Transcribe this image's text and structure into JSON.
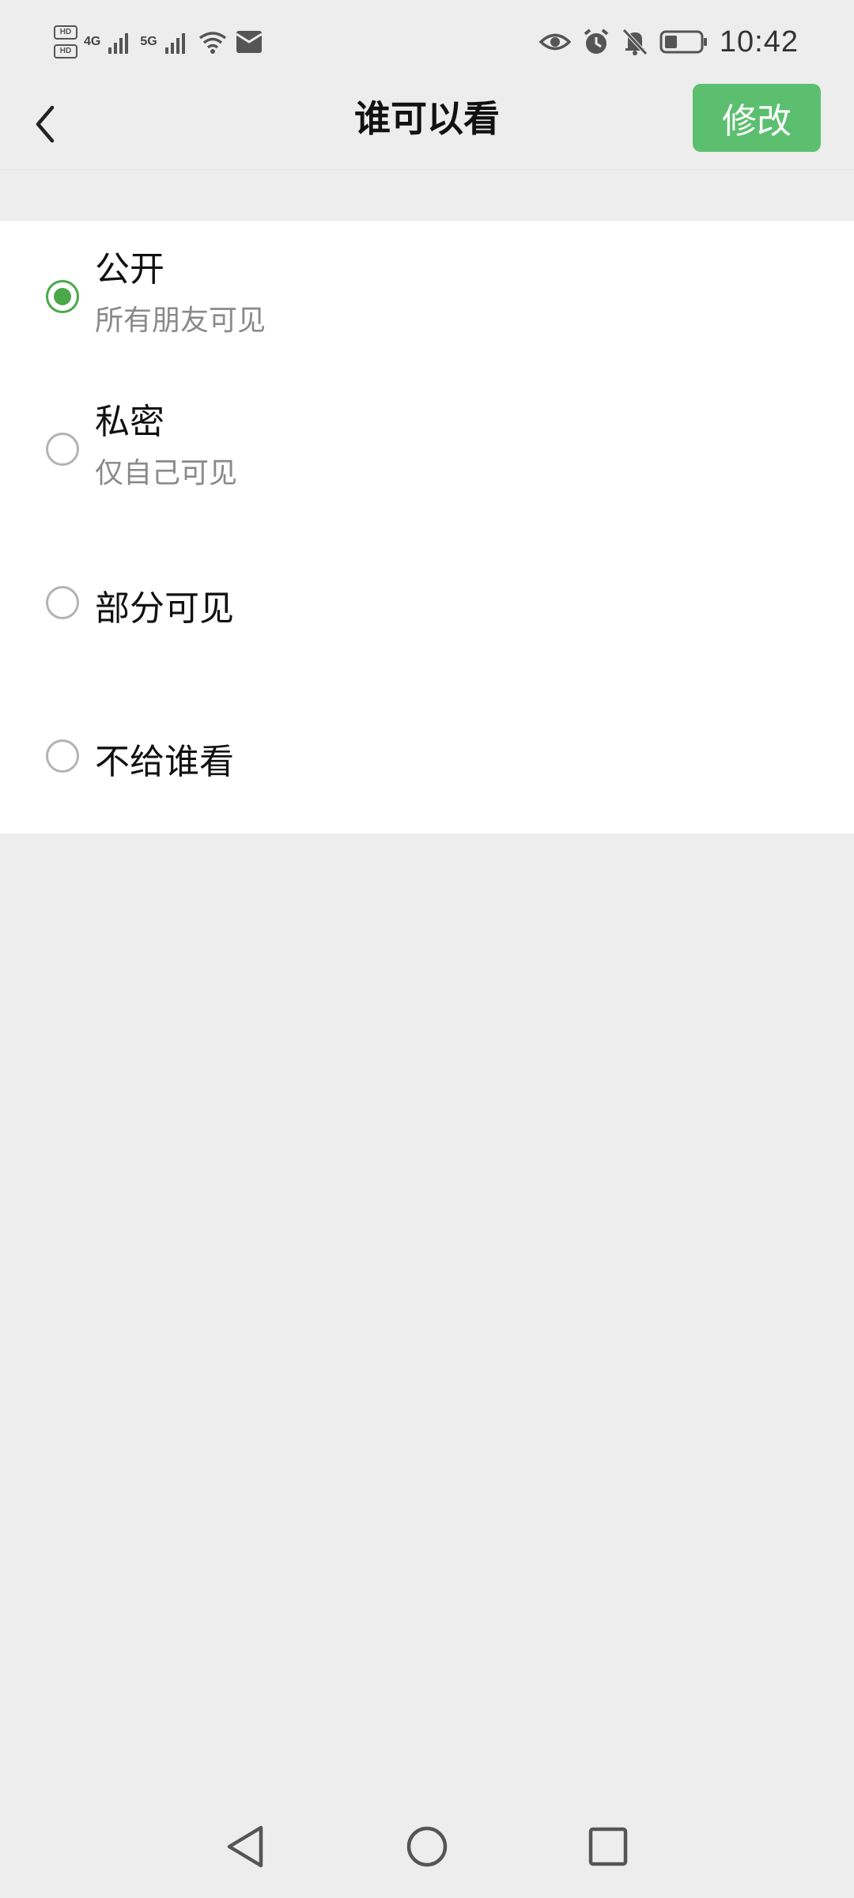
{
  "status_bar": {
    "time": "10:42",
    "network_1": "4G",
    "network_2": "5G",
    "hd_1": "HD",
    "hd_2": "HD",
    "icons": [
      "signal-icon",
      "wifi-icon",
      "notification-envelope-icon",
      "eye-icon",
      "alarm-icon",
      "mute-icon",
      "battery-icon"
    ]
  },
  "header": {
    "title": "谁可以看",
    "edit_label": "修改",
    "accent_color": "#5cbf70"
  },
  "options": [
    {
      "title": "公开",
      "subtitle": "所有朋友可见",
      "checked": true
    },
    {
      "title": "私密",
      "subtitle": "仅自己可见",
      "checked": false
    },
    {
      "title": "部分可见",
      "checked": false
    },
    {
      "title": "不给谁看",
      "checked": false
    }
  ],
  "nav_bar": {
    "icons": [
      "back-triangle-icon",
      "home-circle-icon",
      "recents-square-icon"
    ]
  }
}
